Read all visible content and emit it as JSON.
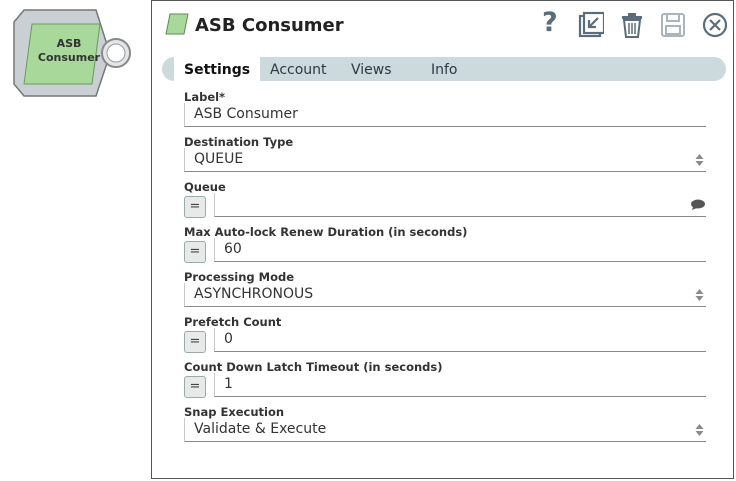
{
  "node": {
    "label": "ASB Consumer"
  },
  "dialog": {
    "title": "ASB Consumer",
    "help_label": "?",
    "tabs": [
      {
        "label": "Settings",
        "active": true
      },
      {
        "label": "Account",
        "active": false
      },
      {
        "label": "Views",
        "active": false
      },
      {
        "label": "Info",
        "active": false
      }
    ],
    "fields": {
      "label": {
        "label": "Label*",
        "value": "ASB Consumer"
      },
      "destination_type": {
        "label": "Destination Type",
        "value": "QUEUE"
      },
      "queue": {
        "label": "Queue",
        "value": "",
        "expr_button": "="
      },
      "max_auto_lock": {
        "label": "Max Auto-lock Renew Duration (in seconds)",
        "value": "60",
        "expr_button": "="
      },
      "processing_mode": {
        "label": "Processing Mode",
        "value": "ASYNCHRONOUS"
      },
      "prefetch_count": {
        "label": "Prefetch Count",
        "value": "0",
        "expr_button": "="
      },
      "latch_timeout": {
        "label": "Count Down Latch Timeout (in seconds)",
        "value": "1",
        "expr_button": "="
      },
      "snap_execution": {
        "label": "Snap Execution",
        "value": "Validate & Execute"
      }
    }
  },
  "icons": {
    "title": "snap-parallelogram-icon",
    "help": "help-icon",
    "expand": "expand-icon",
    "delete": "trash-icon",
    "save": "save-icon",
    "close": "close-icon"
  },
  "colors": {
    "snap_green": "#a8d89a",
    "tab_bar": "#ccd9dd",
    "icon_gray": "#5a6d7a"
  }
}
